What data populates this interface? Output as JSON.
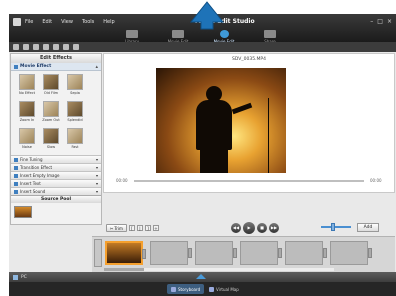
{
  "menu": [
    "File",
    "Edit",
    "View",
    "Tools",
    "Help"
  ],
  "app_title": "Movie Edit Studio",
  "modes": [
    {
      "label": "Library"
    },
    {
      "label": "Movie Edit"
    },
    {
      "label": "Movie Edit"
    },
    {
      "label": "Share"
    }
  ],
  "left_panel": {
    "title": "Edit Effects",
    "movie_effect": "Movie Effect",
    "effects": [
      "No Effect",
      "Old Film",
      "Sepia",
      "Zoom In",
      "Zoom Out",
      "Splendid",
      "Noise",
      "Slow",
      "Fast"
    ],
    "sections": [
      "Fine Tuning",
      "Transition Effect",
      "Insert Empty Image",
      "Insert Text",
      "Insert Sound"
    ],
    "source_pool": "Source Pool"
  },
  "preview": {
    "filename": "SDV_0035.MP4",
    "time_start": "00:00",
    "time_end": "00:00"
  },
  "controls": {
    "trim": "Trim",
    "add": "Add"
  },
  "clips": [
    "",
    "",
    "",
    "",
    "",
    ""
  ],
  "status": {
    "label": "PC"
  },
  "bottom_tabs": [
    "Storyboard",
    "Virtual Map"
  ],
  "colors": {
    "accent": "#3f9ad9",
    "active_clip": "#f5a02e",
    "titlebar": "#1b1b1b"
  }
}
